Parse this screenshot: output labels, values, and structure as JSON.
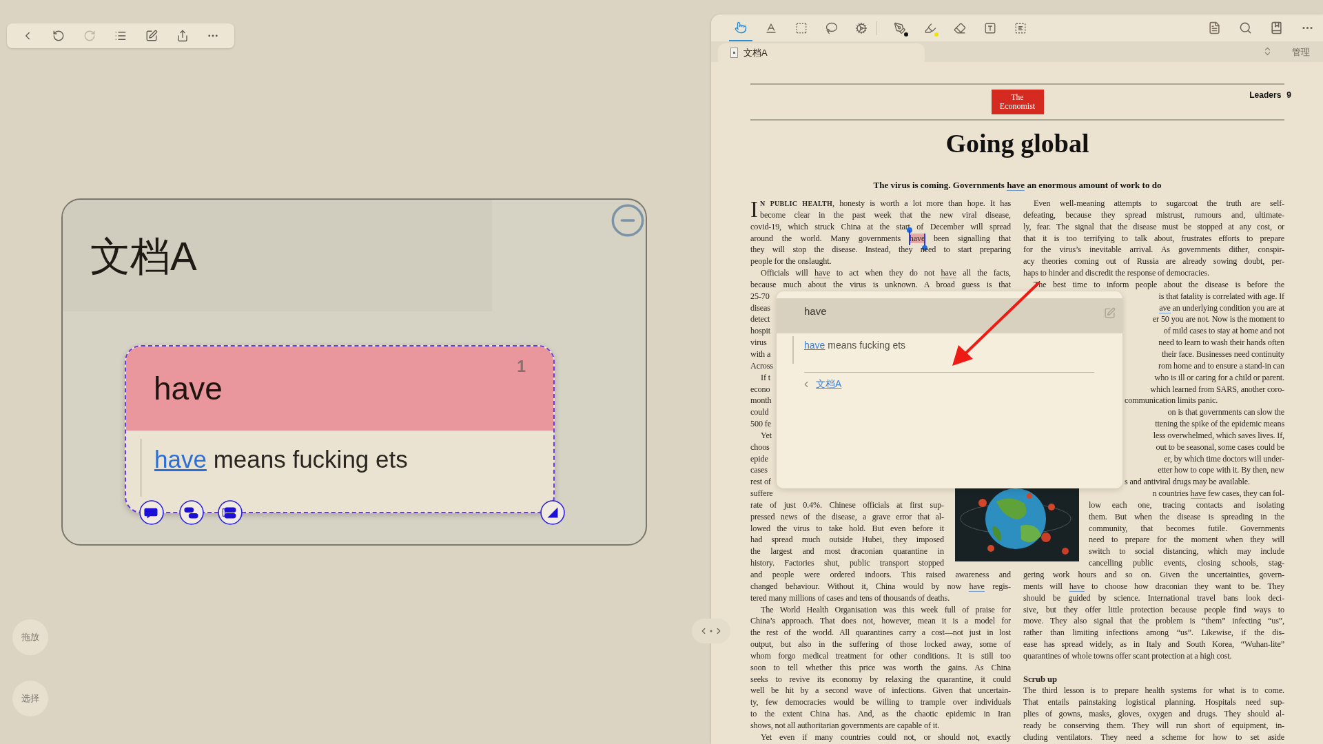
{
  "toolbar": {
    "actions": [
      {
        "kind": "back",
        "disabled": false
      },
      {
        "kind": "undo",
        "disabled": false
      },
      {
        "kind": "redo",
        "disabled": true
      },
      {
        "kind": "outline",
        "disabled": false
      },
      {
        "kind": "edit",
        "disabled": false
      },
      {
        "kind": "share",
        "disabled": false
      },
      {
        "kind": "more",
        "disabled": false
      }
    ]
  },
  "mind_map": {
    "title": "文档A",
    "note": {
      "title": "have",
      "count": "1",
      "link": "have",
      "text": "means fucking ets"
    }
  },
  "side_buttons": [
    "拖放",
    "选择"
  ],
  "reader": {
    "tools": [
      {
        "kind": "pointer",
        "selected": true
      },
      {
        "kind": "text",
        "selected": false
      },
      {
        "kind": "area",
        "selected": false
      },
      {
        "kind": "lasso",
        "selected": false
      },
      {
        "kind": "settings",
        "selected": false
      },
      {
        "kind": "pen",
        "selected": false,
        "color": "#111111"
      },
      {
        "kind": "highlighter",
        "selected": false,
        "color": "#f0e400"
      },
      {
        "kind": "eraser",
        "selected": false
      },
      {
        "kind": "textbox",
        "selected": false
      },
      {
        "kind": "ocr",
        "selected": false
      }
    ],
    "tab": {
      "label": "文档A"
    },
    "manage": "管理",
    "article": {
      "logo": [
        "The",
        "Economist"
      ],
      "section": "Leaders",
      "page": "9",
      "title": "Going global",
      "subtitle": [
        "The virus is coming. Governments ",
        {
          "text": "have",
          "kind": "annotated"
        },
        " an enormous amount of work to do"
      ],
      "left_column": [
        {
          "kind": "dropcap",
          "initial": "I",
          "parts": [
            {
              "text": "N PUBLIC HEALTH",
              "kind": "smallcaps"
            },
            ", honesty is worth a lot more than hope. It has"
          ]
        },
        {
          "kind": "hanging",
          "parts": [
            "become clear in the past week that the new viral disease,"
          ]
        },
        {
          "kind": "justified",
          "parts": [
            "covid-19, which struck China at the start of December will spread"
          ]
        },
        {
          "kind": "justified",
          "parts": [
            "around the world. Many governments ",
            {
              "text": "have",
              "kind": "selected"
            },
            " been signalling that"
          ]
        },
        {
          "kind": "justified",
          "parts": [
            "they will stop the disease. Instead, they need to start preparing"
          ]
        },
        {
          "kind": "last",
          "parts": [
            "people for the onslaught."
          ]
        },
        {
          "kind": "indented",
          "parts": [
            "Officials will ",
            {
              "text": "have",
              "kind": "annotated"
            },
            " to act when they do not ",
            {
              "text": "have",
              "kind": "annotated"
            },
            " all the facts,"
          ]
        },
        {
          "kind": "justified",
          "parts": [
            "because much about the virus is unknown. A broad guess is that"
          ]
        },
        {
          "kind": "fragment",
          "parts": [
            "25-70"
          ]
        },
        {
          "kind": "fragment",
          "parts": [
            "diseas"
          ]
        },
        {
          "kind": "fragment",
          "parts": [
            "detect"
          ]
        },
        {
          "kind": "fragment",
          "parts": [
            "hospit"
          ]
        },
        {
          "kind": "fragment",
          "parts": [
            "virus"
          ]
        },
        {
          "kind": "fragment",
          "parts": [
            "with a"
          ]
        },
        {
          "kind": "fragment",
          "parts": [
            "Across"
          ]
        },
        {
          "kind": "indented-fragment",
          "parts": [
            "If t"
          ]
        },
        {
          "kind": "fragment",
          "parts": [
            "econo"
          ]
        },
        {
          "kind": "fragment",
          "parts": [
            "month"
          ]
        },
        {
          "kind": "fragment",
          "parts": [
            "could"
          ]
        },
        {
          "kind": "fragment",
          "parts": [
            "500 fe"
          ]
        },
        {
          "kind": "indented-fragment",
          "parts": [
            "Yet"
          ]
        },
        {
          "kind": "fragment",
          "parts": [
            "choos"
          ]
        },
        {
          "kind": "fragment",
          "parts": [
            "epide"
          ]
        },
        {
          "kind": "fragment",
          "parts": [
            "cases"
          ]
        },
        {
          "kind": "fragment",
          "parts": [
            "rest of"
          ]
        },
        {
          "kind": "fragment",
          "parts": [
            "suffere"
          ]
        },
        {
          "kind": "narrow",
          "parts": [
            "rate of just 0.4%. Chinese officials at first sup-"
          ]
        },
        {
          "kind": "narrow",
          "parts": [
            "pressed news of the disease, a grave error that al-"
          ]
        },
        {
          "kind": "narrow",
          "parts": [
            "lowed the virus to take hold. But even before it"
          ]
        },
        {
          "kind": "narrow",
          "parts": [
            "had spread much outside Hubei, they imposed"
          ]
        },
        {
          "kind": "narrow",
          "parts": [
            "the largest and most draconian quarantine in"
          ]
        },
        {
          "kind": "narrow",
          "parts": [
            "history. Factories shut, public transport stopped"
          ]
        },
        {
          "kind": "justified",
          "parts": [
            "and people were ordered indoors. This raised awareness and"
          ]
        },
        {
          "kind": "justified",
          "parts": [
            "changed behaviour. Without it, China would by now ",
            {
              "text": "have",
              "kind": "annotated"
            },
            " regis-"
          ]
        },
        {
          "kind": "last",
          "parts": [
            "tered many millions of cases and tens of thousands of deaths."
          ]
        },
        {
          "kind": "indented",
          "parts": [
            "The World Health Organisation was this week full of praise for"
          ]
        },
        {
          "kind": "justified",
          "parts": [
            "China’s approach. That does not, however, mean it is a model for"
          ]
        },
        {
          "kind": "justified",
          "parts": [
            "the rest of the world. All quarantines carry a cost—not just in lost"
          ]
        },
        {
          "kind": "justified",
          "parts": [
            "output, but also in the suffering of those locked away, some of"
          ]
        },
        {
          "kind": "justified",
          "parts": [
            "whom forgo medical treatment for other conditions. It is still too"
          ]
        },
        {
          "kind": "justified",
          "parts": [
            "soon to tell whether this price was worth the gains. As China"
          ]
        },
        {
          "kind": "justified",
          "parts": [
            "seeks to revive its economy by relaxing the quarantine, it could"
          ]
        },
        {
          "kind": "justified",
          "parts": [
            "well be hit by a second wave of infections. Given that uncertain-"
          ]
        },
        {
          "kind": "justified",
          "parts": [
            "ty, few democracies would be willing to trample over individuals"
          ]
        },
        {
          "kind": "justified",
          "parts": [
            "to the extent China has. And, as the chaotic epidemic in Iran"
          ]
        },
        {
          "kind": "last",
          "parts": [
            "shows, not all authoritarian governments are capable of it."
          ]
        },
        {
          "kind": "indented",
          "parts": [
            "Yet even if many countries could not, or should not, exactly"
          ]
        }
      ],
      "right_column": [
        {
          "kind": "indented",
          "parts": [
            "Even well-meaning attempts to sugarcoat the truth are self-"
          ]
        },
        {
          "kind": "justified",
          "parts": [
            "defeating, because they spread mistrust, rumours and, ultimate-"
          ]
        },
        {
          "kind": "justified",
          "parts": [
            "ly, fear. The signal that the disease must be stopped at any cost, or"
          ]
        },
        {
          "kind": "justified",
          "parts": [
            "that it is too terrifying to talk about, frustrates efforts to prepare"
          ]
        },
        {
          "kind": "justified",
          "parts": [
            "for the virus’s inevitable arrival. As governments dither, conspir-"
          ]
        },
        {
          "kind": "justified",
          "parts": [
            "acy theories coming out of Russia are already sowing doubt, per-"
          ]
        },
        {
          "kind": "last",
          "parts": [
            "haps to hinder and discredit the response of democracies."
          ]
        },
        {
          "kind": "indented",
          "parts": [
            "The best time to inform people about the disease is before the"
          ]
        },
        {
          "kind": "fragment",
          "parts": [
            "is that fatality is correlated with age. If"
          ]
        },
        {
          "kind": "fragment",
          "parts": [
            {
              "text": "ave",
              "kind": "annotated"
            },
            " an underlying condition you are at"
          ]
        },
        {
          "kind": "fragment",
          "parts": [
            "er 50 you are not. Now is the moment to"
          ]
        },
        {
          "kind": "fragment",
          "parts": [
            "of mild cases to stay at home and not"
          ]
        },
        {
          "kind": "fragment",
          "parts": [
            "need to learn to wash their hands often"
          ]
        },
        {
          "kind": "fragment",
          "parts": [
            "their face. Businesses need continuity"
          ]
        },
        {
          "kind": "fragment",
          "parts": [
            "rom home and to ensure a stand-in can"
          ]
        },
        {
          "kind": "fragment",
          "parts": [
            "who is ill or caring for a child or parent."
          ]
        },
        {
          "kind": "fragment",
          "parts": [
            "which learned from SARS, another coro-"
          ]
        },
        {
          "kind": "fragment-end",
          "parts": [
            "communication limits panic."
          ]
        },
        {
          "kind": "fragment",
          "parts": [
            "on is that governments can slow the"
          ]
        },
        {
          "kind": "fragment",
          "parts": [
            "ttening the spike of the epidemic means"
          ]
        },
        {
          "kind": "fragment",
          "parts": [
            "less overwhelmed, which saves lives. If,"
          ]
        },
        {
          "kind": "fragment",
          "parts": [
            "out to be seasonal, some cases could be"
          ]
        },
        {
          "kind": "fragment",
          "parts": [
            "er, by which time doctors will under-"
          ]
        },
        {
          "kind": "fragment",
          "parts": [
            "etter how to cope with it. By then, new"
          ]
        },
        {
          "kind": "fragment-end",
          "parts": [
            "s and antiviral drugs may be available."
          ]
        },
        {
          "kind": "fragment",
          "parts": [
            "n countries ",
            {
              "text": "have",
              "kind": "annotated"
            },
            " few cases, they can fol-"
          ]
        },
        {
          "kind": "narrow",
          "parts": [
            "low each one, tracing contacts and isolating"
          ]
        },
        {
          "kind": "narrow",
          "parts": [
            "them. But when the disease is spreading in the"
          ]
        },
        {
          "kind": "narrow",
          "parts": [
            "community, that becomes futile. Governments"
          ]
        },
        {
          "kind": "narrow",
          "parts": [
            "need to prepare for the moment when they will"
          ]
        },
        {
          "kind": "narrow",
          "parts": [
            "switch to social distancing, which may include"
          ]
        },
        {
          "kind": "narrow",
          "parts": [
            "cancelling public events, closing schools, stag-"
          ]
        },
        {
          "kind": "justified",
          "parts": [
            "gering work hours and so on. Given the uncertainties, govern-"
          ]
        },
        {
          "kind": "justified",
          "parts": [
            "ments will ",
            {
              "text": "have",
              "kind": "annotated"
            },
            " to choose how draconian they want to be. They"
          ]
        },
        {
          "kind": "justified",
          "parts": [
            "should be guided by science. International travel bans look deci-"
          ]
        },
        {
          "kind": "justified",
          "parts": [
            "sive, but they offer little protection because people find ways to"
          ]
        },
        {
          "kind": "justified",
          "parts": [
            "move. They also signal that the problem is “them” infecting “us”,"
          ]
        },
        {
          "kind": "justified",
          "parts": [
            "rather than limiting infections among “us”. Likewise, if the dis-"
          ]
        },
        {
          "kind": "justified",
          "parts": [
            "ease has spread widely, as in Italy and South Korea, “Wuhan-lite”"
          ]
        },
        {
          "kind": "last",
          "parts": [
            "quarantines of whole towns offer scant protection at a high cost."
          ]
        },
        {
          "kind": "heading",
          "parts": [
            "Scrub up"
          ]
        },
        {
          "kind": "justified",
          "parts": [
            "The third lesson is to prepare health systems for what is to come."
          ]
        },
        {
          "kind": "justified",
          "parts": [
            "That entails painstaking logistical planning. Hospitals need sup-"
          ]
        },
        {
          "kind": "justified",
          "parts": [
            "plies of gowns, masks, gloves, oxygen and drugs. They should al-"
          ]
        },
        {
          "kind": "justified",
          "parts": [
            "ready be conserving them. They will run short of equipment, in-"
          ]
        },
        {
          "kind": "justified",
          "parts": [
            "cluding ventilators. They need a scheme for how to set aside"
          ]
        }
      ]
    },
    "popup": {
      "title": "have",
      "link": "have",
      "text": "means fucking ets",
      "source": "文档A"
    }
  }
}
